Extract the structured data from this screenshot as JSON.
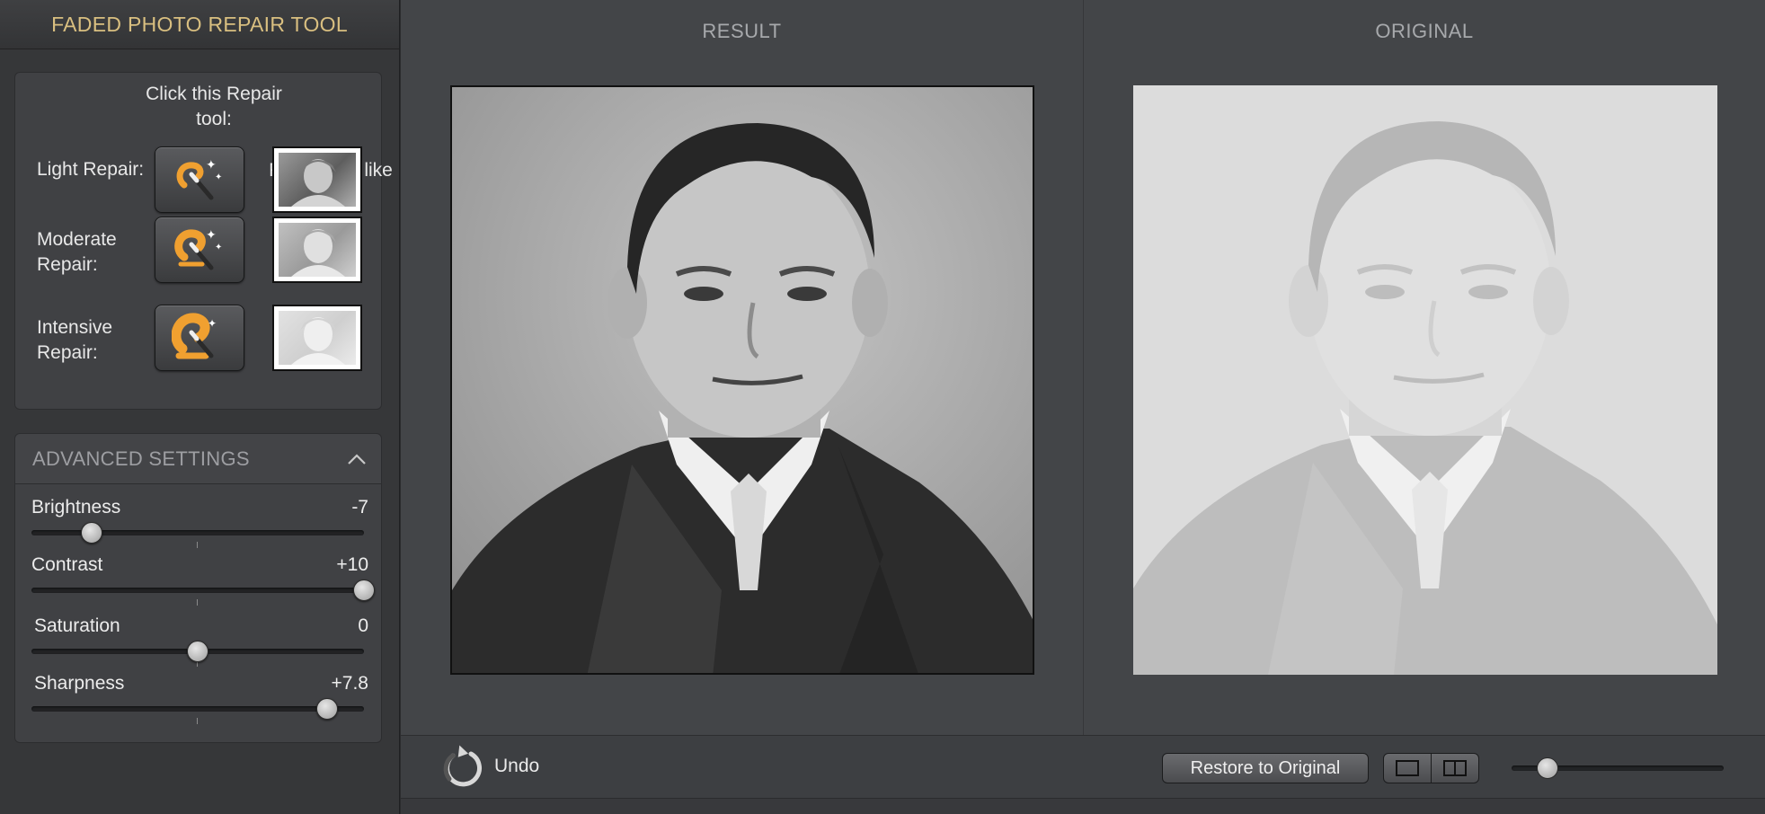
{
  "app": {
    "title": "FADED PHOTO REPAIR TOOL"
  },
  "repair": {
    "col_tool": "Click this Repair tool:",
    "col_photo": "For photos like this:",
    "rows": [
      {
        "label": "Light Repair:"
      },
      {
        "label": "Moderate Repair:"
      },
      {
        "label": "Intensive Repair:"
      }
    ]
  },
  "advanced": {
    "title": "ADVANCED SETTINGS",
    "sliders": [
      {
        "name": "Brightness",
        "value": "-7",
        "fraction": 0.18
      },
      {
        "name": "Contrast",
        "value": "+10",
        "fraction": 1.0
      },
      {
        "name": "Saturation",
        "value": "0",
        "fraction": 0.5
      },
      {
        "name": "Sharpness",
        "value": "+7.8",
        "fraction": 0.89
      }
    ]
  },
  "panes": {
    "result": "RESULT",
    "original": "ORIGINAL"
  },
  "toolbar": {
    "undo": "Undo",
    "restore": "Restore to Original",
    "zoom_fraction": 0.17
  },
  "colors": {
    "accent": "#d9bf80",
    "panel": "#404144",
    "main_bg": "#434548"
  }
}
